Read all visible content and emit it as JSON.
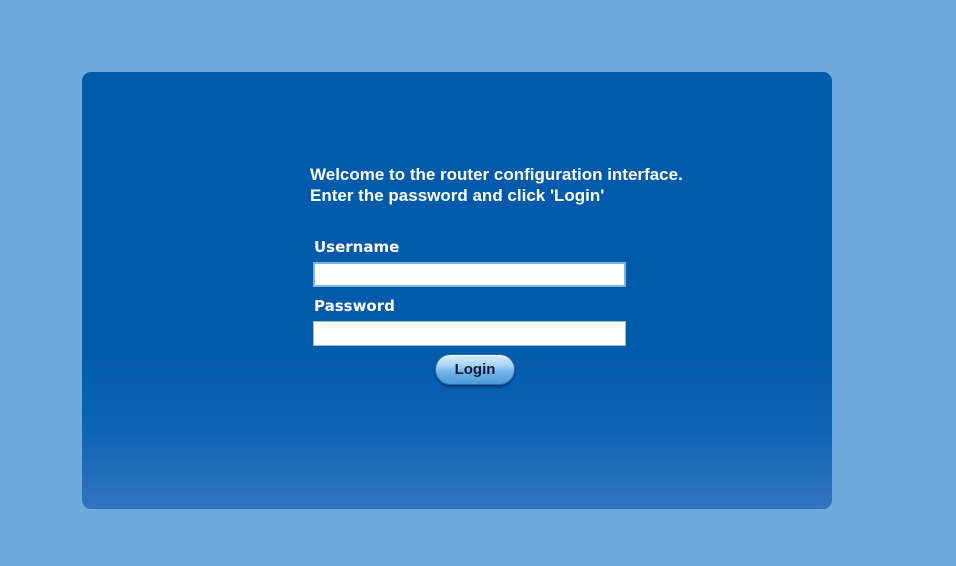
{
  "welcome": {
    "line1": "Welcome to the router configuration interface.",
    "line2": "Enter the password and click 'Login'"
  },
  "form": {
    "username_label": "Username",
    "username_value": "",
    "password_label": "Password",
    "password_value": "",
    "login_label": "Login"
  },
  "colors": {
    "page_background": "#6eaadc",
    "panel_background": "#005aac",
    "text": "#ffffff"
  }
}
